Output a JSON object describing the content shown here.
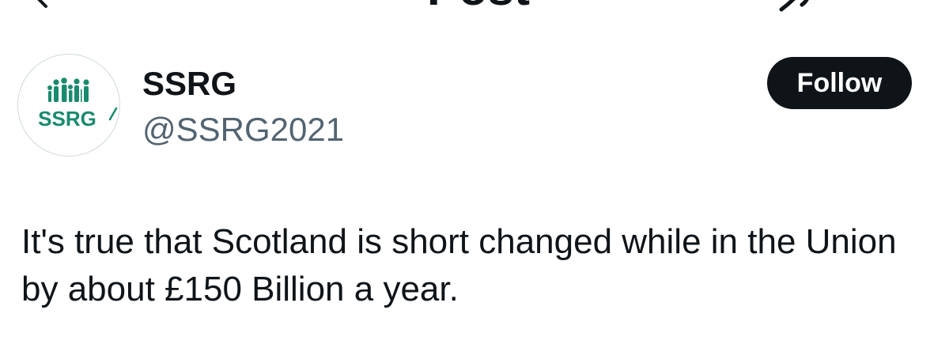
{
  "header": {
    "title": "Post",
    "back_icon": "arrow-left-icon",
    "grok_icon": "grok-icon"
  },
  "author": {
    "name": "SSRG",
    "handle": "@SSRG2021",
    "avatar_text": "SSRG",
    "avatar_color": "#1a8a6e"
  },
  "follow": {
    "label": "Follow"
  },
  "post": {
    "text": "It's true that Scotland is short changed while in the Union by about £150 Billion a year."
  },
  "colors": {
    "text_primary": "#0f1419",
    "text_secondary": "#536471",
    "button_bg": "#0f1419",
    "button_text": "#ffffff",
    "brand_green": "#1a8a6e"
  }
}
